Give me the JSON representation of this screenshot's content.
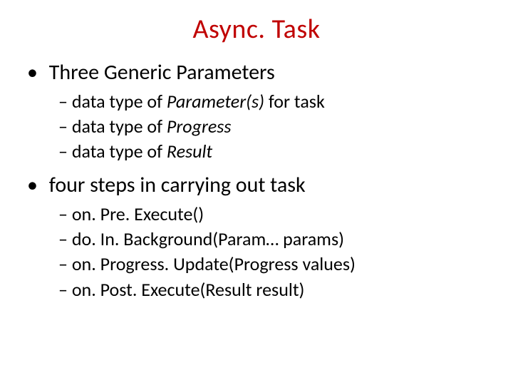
{
  "title": "Async. Task",
  "sections": [
    {
      "heading": "Three Generic Parameters",
      "items": [
        {
          "prefix": "data type of ",
          "em": "Parameter(s)",
          "suffix": " for task"
        },
        {
          "prefix": "data type of ",
          "em": "Progress",
          "suffix": ""
        },
        {
          "prefix": "data type of ",
          "em": "Result",
          "suffix": ""
        }
      ]
    },
    {
      "heading": "four steps in carrying out task",
      "items": [
        {
          "prefix": "on. Pre. Execute()",
          "em": "",
          "suffix": ""
        },
        {
          "prefix": "do. In. Background(Param… params)",
          "em": "",
          "suffix": ""
        },
        {
          "prefix": "on. Progress. Update(Progress values)",
          "em": "",
          "suffix": ""
        },
        {
          "prefix": "on. Post. Execute(Result result)",
          "em": "",
          "suffix": ""
        }
      ]
    }
  ]
}
